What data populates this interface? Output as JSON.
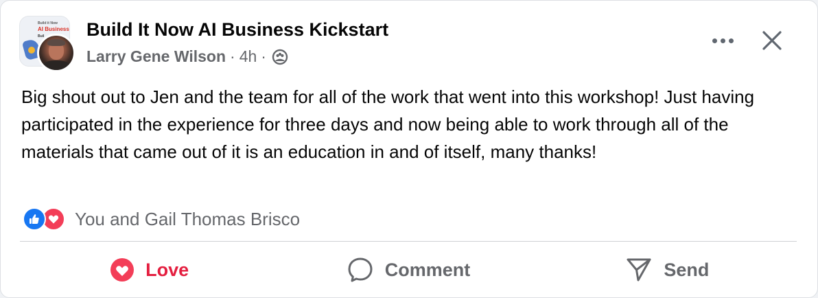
{
  "post": {
    "group_thumb": {
      "line1": "Build it Now",
      "line2": "AI Business K",
      "line3": "Buil"
    },
    "title": "Build It Now AI Business Kickstart",
    "author": "Larry Gene Wilson",
    "separator": "·",
    "time": "4h",
    "audience_icon": "group-audience-icon",
    "body": "Big shout out to Jen and the team for all of the work that went into this workshop! Just having participated in the experience for three days and now being able to work through all of the materials that came out of it is an education in and of itself, many thanks!",
    "reactions": {
      "icons": [
        "like-reaction-icon",
        "love-reaction-icon"
      ],
      "text": "You and Gail Thomas Brisco"
    },
    "actions": [
      {
        "label": "Love",
        "icon": "love-icon",
        "active": true
      },
      {
        "label": "Comment",
        "icon": "comment-icon"
      },
      {
        "label": "Send",
        "icon": "send-icon"
      }
    ]
  },
  "colors": {
    "love_active": "#e41e3f",
    "like_blue": "#1877f2",
    "love_red": "#f33e58",
    "muted_text": "#65676b"
  }
}
